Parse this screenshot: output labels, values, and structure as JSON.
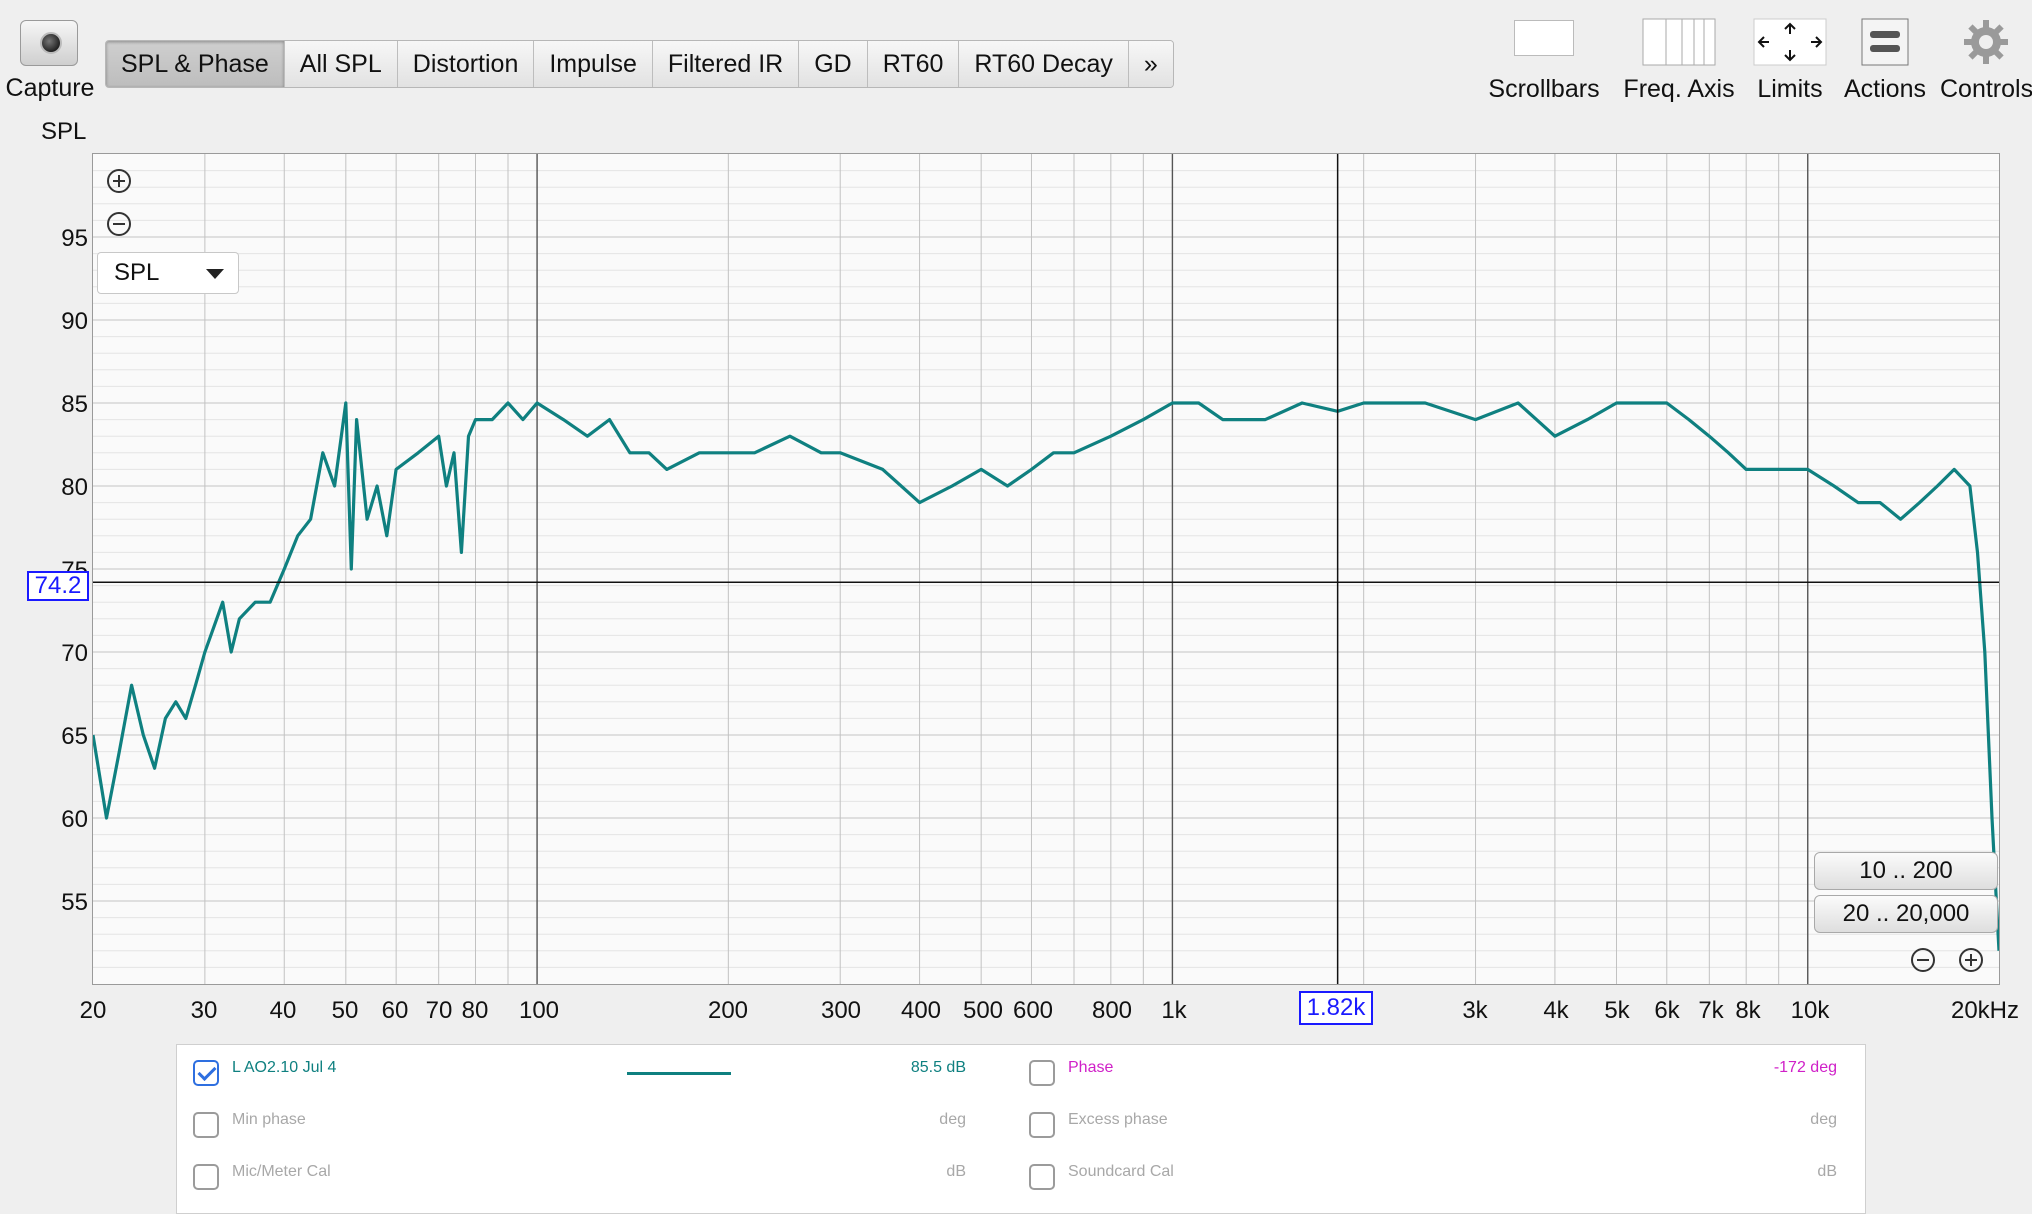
{
  "toolbar": {
    "capture_label": "Capture",
    "tabs": [
      {
        "label": "SPL & Phase",
        "active": true
      },
      {
        "label": "All SPL",
        "active": false
      },
      {
        "label": "Distortion",
        "active": false
      },
      {
        "label": "Impulse",
        "active": false
      },
      {
        "label": "Filtered IR",
        "active": false
      },
      {
        "label": "GD",
        "active": false
      },
      {
        "label": "RT60",
        "active": false
      },
      {
        "label": "RT60 Decay",
        "active": false
      },
      {
        "label": "»",
        "active": false
      }
    ],
    "tools": {
      "scrollbars": "Scrollbars",
      "freq_axis": "Freq. Axis",
      "limits": "Limits",
      "actions": "Actions",
      "controls": "Controls"
    }
  },
  "graph": {
    "y_title": "SPL",
    "selector_value": "SPL",
    "cursor_y": "74.2",
    "cursor_x": "1.82k",
    "y_ticks": [
      "95",
      "90",
      "85",
      "80",
      "75",
      "70",
      "65",
      "60",
      "55"
    ],
    "x_ticks": [
      "20",
      "30",
      "40",
      "50",
      "60",
      "70",
      "80",
      "100",
      "200",
      "300",
      "400",
      "500",
      "600",
      "800",
      "1k",
      "3k",
      "4k",
      "5k",
      "6k",
      "7k",
      "8k",
      "10k",
      "20kHz"
    ],
    "range_buttons": [
      "10 .. 200",
      "20 .. 20,000"
    ]
  },
  "chart_data": {
    "type": "line",
    "xscale": "log",
    "xlim": [
      20,
      20000
    ],
    "ylim": [
      50,
      100
    ],
    "ylabel": "SPL",
    "grid": true,
    "series": [
      {
        "name": "L AO2.10 Jul 4",
        "color": "#0f8080",
        "x": [
          20,
          21,
          22,
          23,
          24,
          25,
          26,
          27,
          28,
          29,
          30,
          32,
          33,
          34,
          36,
          38,
          40,
          42,
          44,
          46,
          48,
          50,
          51,
          52,
          54,
          56,
          58,
          60,
          65,
          70,
          72,
          74,
          76,
          78,
          80,
          85,
          90,
          95,
          100,
          110,
          120,
          130,
          140,
          150,
          160,
          180,
          200,
          220,
          250,
          280,
          300,
          350,
          400,
          450,
          500,
          550,
          600,
          650,
          700,
          800,
          900,
          1000,
          1100,
          1200,
          1400,
          1600,
          1820,
          2000,
          2500,
          3000,
          3500,
          4000,
          4500,
          5000,
          5500,
          6000,
          6500,
          7000,
          7500,
          8000,
          9000,
          10000,
          11000,
          12000,
          13000,
          14000,
          15000,
          16000,
          17000,
          18000,
          18500,
          19000,
          19500,
          20000
        ],
        "y": [
          65,
          60,
          64,
          68,
          65,
          63,
          66,
          67,
          66,
          68,
          70,
          73,
          70,
          72,
          73,
          73,
          75,
          77,
          78,
          82,
          80,
          85,
          75,
          84,
          78,
          80,
          77,
          81,
          82,
          83,
          80,
          82,
          76,
          83,
          84,
          84,
          85,
          84,
          85,
          84,
          83,
          84,
          82,
          82,
          81,
          82,
          82,
          82,
          83,
          82,
          82,
          81,
          79,
          80,
          81,
          80,
          81,
          82,
          82,
          83,
          84,
          85,
          85,
          84,
          84,
          85,
          84.5,
          85,
          85,
          84,
          85,
          83,
          84,
          85,
          85,
          85,
          84,
          83,
          82,
          81,
          81,
          81,
          80,
          79,
          79,
          78,
          79,
          80,
          81,
          80,
          76,
          70,
          60,
          52
        ]
      }
    ]
  },
  "legend": {
    "rows": [
      {
        "checked": true,
        "label": "L AO2.10 Jul 4",
        "value": "85.5 dB",
        "label2": "Phase",
        "checked2": false,
        "value2": "-172 deg"
      },
      {
        "checked": false,
        "label": "Min phase",
        "value": "deg",
        "label2": "Excess phase",
        "checked2": false,
        "value2": "deg"
      },
      {
        "checked": false,
        "label": "Mic/Meter Cal",
        "value": "dB",
        "label2": "Soundcard Cal",
        "checked2": false,
        "value2": "dB"
      }
    ],
    "colors": {
      "trace": "#0f8080",
      "phase": "#d020c8",
      "disabled": "#a8a8a8",
      "cursor": "#1a1aff"
    }
  }
}
